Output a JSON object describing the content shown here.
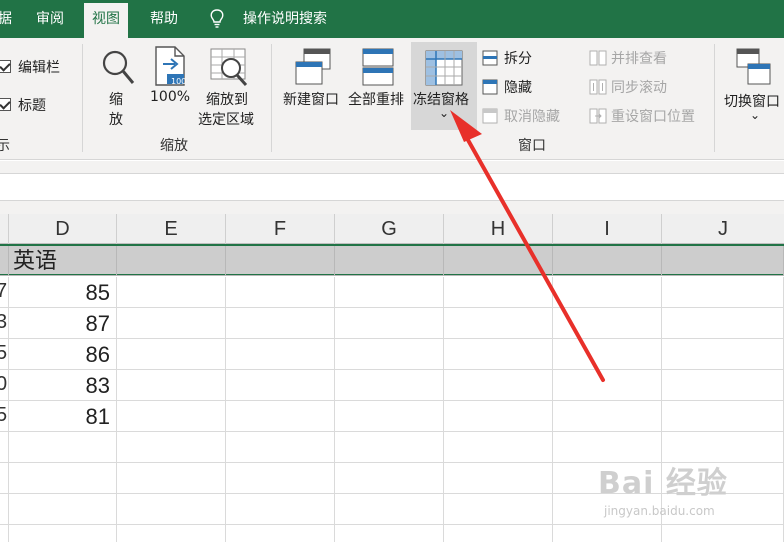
{
  "ribbon_tabs": {
    "data": "据",
    "review": "审阅",
    "view": "视图",
    "help": "帮助",
    "tell_me": "操作说明搜索"
  },
  "show_group": {
    "formula_bar": "编辑栏",
    "headings": "标题",
    "group_label": "示"
  },
  "zoom_group": {
    "zoom_l1": "缩",
    "zoom_l2": "放",
    "zoom_100": "100%",
    "zoom_selection_l1": "缩放到",
    "zoom_selection_l2": "选定区域",
    "icon_100_text": "100",
    "group_label": "缩放"
  },
  "window_group": {
    "new_window": "新建窗口",
    "arrange_all": "全部重排",
    "freeze_panes": "冻结窗格",
    "freeze_dropdown": "⌄",
    "split": "拆分",
    "hide": "隐藏",
    "unhide": "取消隐藏",
    "view_side_by_side": "并排查看",
    "sync_scroll": "同步滚动",
    "reset_position": "重设窗口位置",
    "switch_windows": "切换窗口",
    "switch_dropdown": "⌄",
    "group_label": "窗口"
  },
  "grid": {
    "columns": [
      "D",
      "E",
      "F",
      "G",
      "H",
      "I",
      "J"
    ],
    "header_cell": "英语",
    "row_fragments": [
      "7",
      "3",
      "5",
      "0",
      "5"
    ],
    "values": [
      "85",
      "87",
      "86",
      "83",
      "81"
    ]
  },
  "watermark": {
    "logo": "Bai 经验",
    "url": "jingyan.baidu.com"
  },
  "colors": {
    "excel_green": "#217346",
    "ribbon_bg": "#f3f2f1",
    "arrow_red": "#e8302a"
  }
}
